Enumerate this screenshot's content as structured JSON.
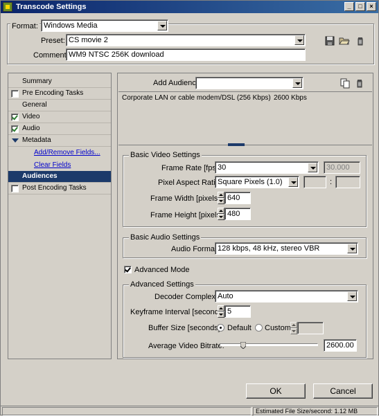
{
  "window": {
    "title": "Transcode Settings",
    "controls": {
      "minimize": "_",
      "maximize": "□",
      "close": "×"
    }
  },
  "header": {
    "format_label": "Format:",
    "format_value": "Windows Media",
    "preset_label": "Preset:",
    "preset_value": "CS movie 2",
    "comment_label": "Comment:",
    "comment_value": "WM9 NTSC 256K download",
    "icons": [
      "save-icon",
      "folder-open-icon",
      "trash-icon"
    ]
  },
  "sidebar": {
    "items": [
      {
        "label": "Summary",
        "checkbox": "none"
      },
      {
        "label": "Pre Encoding Tasks",
        "checkbox": "unchecked"
      },
      {
        "label": "General",
        "checkbox": "none"
      },
      {
        "label": "Video",
        "checkbox": "checked"
      },
      {
        "label": "Audio",
        "checkbox": "checked"
      },
      {
        "label": "Metadata",
        "checkbox": "disclosure"
      },
      {
        "label": "Add/Remove Fields...",
        "type": "link"
      },
      {
        "label": "Clear Fields",
        "type": "link"
      },
      {
        "label": "Audiences",
        "active": true
      },
      {
        "label": "Post Encoding Tasks",
        "checkbox": "unchecked"
      }
    ]
  },
  "audience": {
    "add_label": "Add Audience:",
    "add_value": "",
    "row": {
      "name": "Corporate LAN or cable modem/DSL (256 Kbps)",
      "bitrate": "2600 Kbps"
    }
  },
  "video": {
    "group_title": "Basic Video Settings",
    "frame_rate_label": "Frame Rate [fps]:",
    "frame_rate_value": "30",
    "frame_rate_alt": "30.000",
    "par_label": "Pixel Aspect Ratio:",
    "par_value": "Square Pixels (1.0)",
    "par_sep": ":",
    "width_label": "Frame Width [pixels]:",
    "width_value": "640",
    "height_label": "Frame Height [pixels]:",
    "height_value": "480"
  },
  "audio": {
    "group_title": "Basic Audio Settings",
    "format_label": "Audio Format:",
    "format_value": "128 kbps, 48 kHz, stereo VBR"
  },
  "advanced_mode": {
    "label": "Advanced Mode",
    "checked": true
  },
  "advanced": {
    "group_title": "Advanced Settings",
    "decoder_label": "Decoder Complexity:",
    "decoder_value": "Auto",
    "keyframe_label": "Keyframe Interval [seconds]:",
    "keyframe_value": "5",
    "buffer_label": "Buffer Size [seconds]:",
    "buffer_default": "Default",
    "buffer_custom": "Custom",
    "buffer_custom_value": "",
    "bitrate_label": "Average Video Bitrate:",
    "bitrate_value": "2600.00",
    "bitrate_slider_fraction": 0.24
  },
  "buttons": {
    "ok": "OK",
    "cancel": "Cancel"
  },
  "status": {
    "estimate": "Estimated File Size/second: 1.12 MB"
  }
}
